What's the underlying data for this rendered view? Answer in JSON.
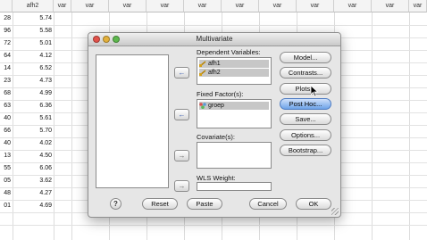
{
  "sheet": {
    "columns": [
      "afh2",
      "var",
      "var",
      "var",
      "var",
      "var",
      "var",
      "var",
      "var",
      "var",
      "var",
      "var"
    ],
    "col_a_values": [
      "28",
      "96",
      "72",
      "64",
      "14",
      "23",
      "68",
      "63",
      "40",
      "66",
      "40",
      "13",
      "55",
      "05",
      "48",
      "01"
    ],
    "col_b_values": [
      "5.74",
      "5.58",
      "5.01",
      "4.12",
      "6.52",
      "4.73",
      "4.99",
      "6.36",
      "5.61",
      "5.70",
      "4.02",
      "4.50",
      "6.06",
      "3.62",
      "4.27",
      "4.69"
    ]
  },
  "dialog": {
    "title": "Multivariate",
    "dependent_label": "Dependent Variables:",
    "dependent_items": [
      "afh1",
      "afh2"
    ],
    "fixed_label": "Fixed Factor(s):",
    "fixed_items": [
      "groep"
    ],
    "covariate_label": "Covariate(s):",
    "wls_label": "WLS Weight:",
    "side_buttons": [
      "Model...",
      "Contrasts...",
      "Plots...",
      "Post Hoc...",
      "Save...",
      "Options...",
      "Bootstrap..."
    ],
    "bottom_buttons": {
      "help": "?",
      "reset": "Reset",
      "paste": "Paste",
      "cancel": "Cancel",
      "ok": "OK"
    }
  }
}
